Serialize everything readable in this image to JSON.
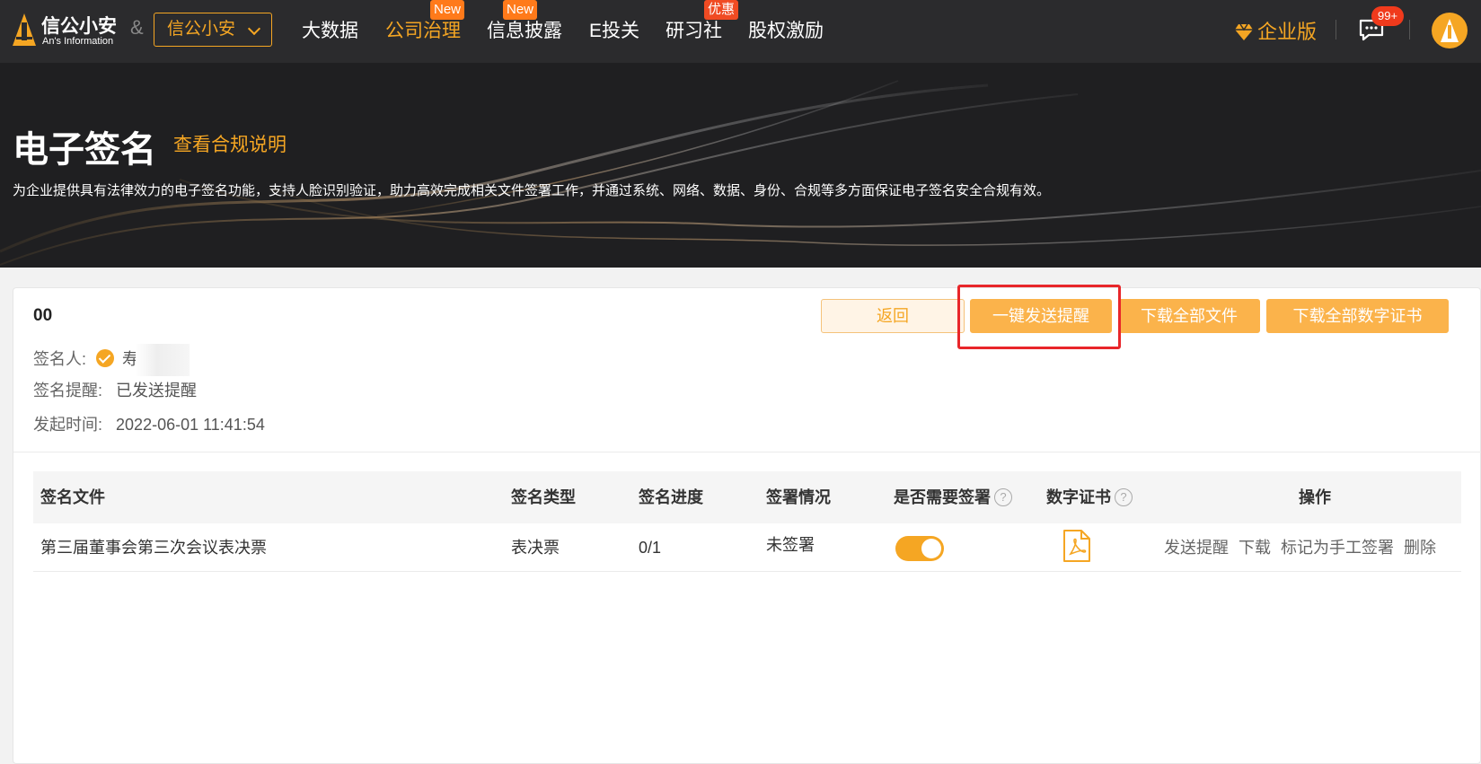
{
  "brand": {
    "name": "信公小安",
    "sub": "An's Information",
    "amp": "&"
  },
  "org_select": {
    "value": "信公小安"
  },
  "nav": [
    {
      "label": "大数据",
      "badge": ""
    },
    {
      "label": "公司治理",
      "badge": "New",
      "active": true
    },
    {
      "label": "信息披露",
      "badge": "New"
    },
    {
      "label": "E投关",
      "badge": ""
    },
    {
      "label": "研习社",
      "badge": "优惠"
    },
    {
      "label": "股权激励",
      "badge": ""
    }
  ],
  "header_right": {
    "enterprise_label": "企业版",
    "messages_badge": "99+"
  },
  "banner": {
    "title": "电子签名",
    "link": "查看合规说明",
    "desc": "为企业提供具有法律效力的电子签名功能，支持人脸识别验证，助力高效完成相关文件签署工作，并通过系统、网络、数据、身份、合规等多方面保证电子签名安全合规有效。"
  },
  "detail": {
    "code": "00",
    "signer_label": "签名人:",
    "signer_name": "寿",
    "reminder_label": "签名提醒:",
    "reminder_value": "已发送提醒",
    "time_label": "发起时间:",
    "time_value": "2022-06-01 11:41:54"
  },
  "actions": {
    "back": "返回",
    "send_reminder": "一键发送提醒",
    "download_all": "下载全部文件",
    "download_certs": "下载全部数字证书"
  },
  "table": {
    "headers": {
      "file": "签名文件",
      "type": "签名类型",
      "progress": "签名进度",
      "status": "签署情况",
      "need_sign": "是否需要签署",
      "cert": "数字证书",
      "ops": "操作"
    },
    "rows": [
      {
        "file": "第三届董事会第三次会议表决票",
        "type": "表决票",
        "progress": "0/1",
        "status": "未签署",
        "need_sign": true,
        "ops": [
          "发送提醒",
          "下载",
          "标记为手工签署",
          "删除"
        ]
      }
    ]
  },
  "colors": {
    "accent": "#f5a623",
    "nav_bg": "#2b2b2d",
    "highlight": "#e8262a"
  }
}
